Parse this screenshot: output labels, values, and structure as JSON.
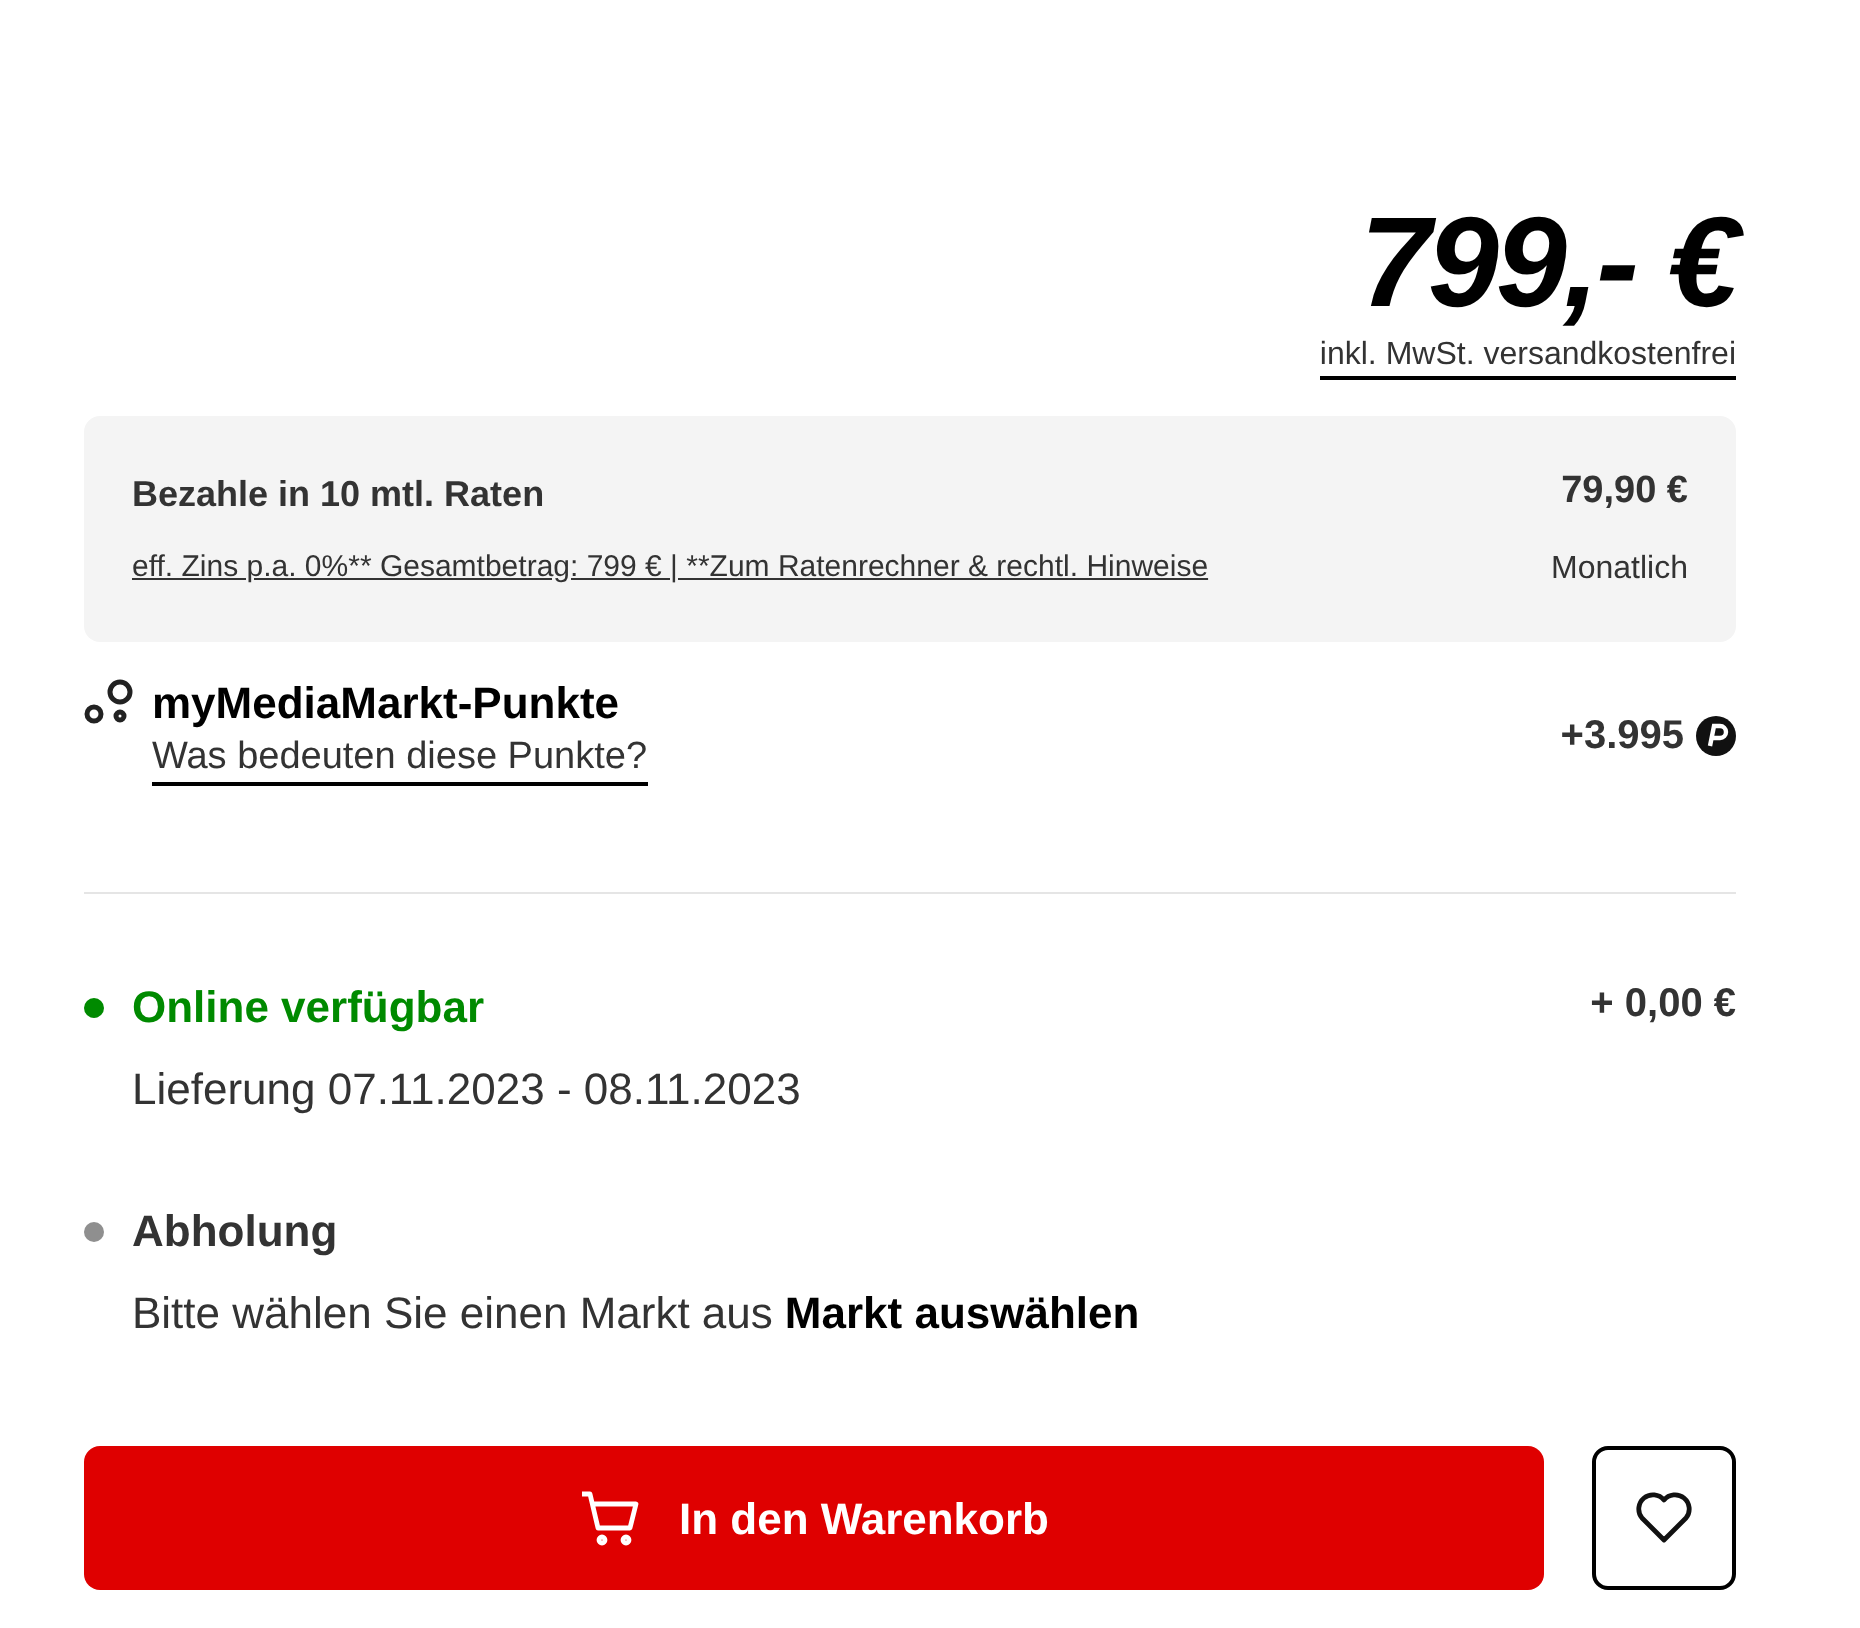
{
  "price": {
    "amount": "799,- €",
    "note": "inkl. MwSt. versandkostenfrei"
  },
  "installments": {
    "title": "Bezahle in 10 mtl. Raten",
    "details": "eff. Zins p.a. 0%** Gesamtbetrag: 799 € | **Zum Ratenrechner & rechtl. Hinweise",
    "amount": "79,90 €",
    "period": "Monatlich"
  },
  "points": {
    "title": "myMediaMarkt-Punkte",
    "link": "Was bedeuten diese Punkte?",
    "value": "+3.995"
  },
  "availability": [
    {
      "title": "Online verfügbar",
      "available": true,
      "color": "#008a00",
      "text": "Lieferung 07.11.2023 - 08.11.2023",
      "price": "+ 0,00 €"
    },
    {
      "title": "Abholung",
      "available": false,
      "color": "#8f8f8f",
      "text": "Bitte wählen Sie einen Markt aus",
      "link": "Markt auswählen"
    }
  ],
  "cart_button": {
    "label": "In den Warenkorb"
  }
}
